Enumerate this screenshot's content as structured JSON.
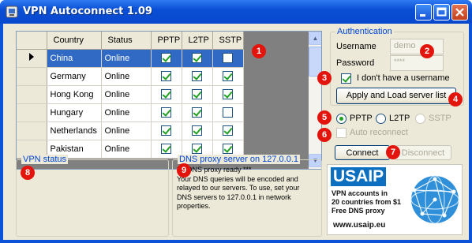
{
  "window": {
    "title": "VPN Autoconnect 1.09"
  },
  "grid": {
    "columns": [
      "Country",
      "Status",
      "PPTP",
      "L2TP",
      "SSTP"
    ],
    "rows": [
      {
        "country": "China",
        "status": "Online",
        "pptp": true,
        "l2tp": true,
        "sstp": false,
        "selected": true
      },
      {
        "country": "Germany",
        "status": "Online",
        "pptp": true,
        "l2tp": true,
        "sstp": true,
        "selected": false
      },
      {
        "country": "Hong Kong",
        "status": "Online",
        "pptp": true,
        "l2tp": true,
        "sstp": true,
        "selected": false
      },
      {
        "country": "Hungary",
        "status": "Online",
        "pptp": true,
        "l2tp": true,
        "sstp": false,
        "selected": false
      },
      {
        "country": "Netherlands",
        "status": "Online",
        "pptp": true,
        "l2tp": true,
        "sstp": true,
        "selected": false
      },
      {
        "country": "Pakistan",
        "status": "Online",
        "pptp": true,
        "l2tp": true,
        "sstp": true,
        "selected": false
      }
    ]
  },
  "auth": {
    "legend": "Authentication",
    "username_label": "Username",
    "username_value": "demo",
    "password_label": "Password",
    "password_value": "****",
    "no_username_label": "I don't have a username",
    "no_username_checked": true,
    "apply_button": "Apply and Load server list"
  },
  "protocol": {
    "pptp": "PPTP",
    "l2tp": "L2TP",
    "sstp": "SSTP",
    "auto_reconnect": "Auto reconnect"
  },
  "actions": {
    "connect": "Connect",
    "disconnect": "Disconnect"
  },
  "vpn_status": {
    "legend": "VPN status"
  },
  "dns": {
    "legend": "DNS proxy server on 127.0.0.1",
    "lines": [
      "*** DNS proxy ready ***",
      "Your DNS queries will be encoded and",
      "relayed to our servers. To use, set your",
      "DNS servers to 127.0.0.1 in network",
      "properties."
    ]
  },
  "ad": {
    "brand": "USAIP",
    "line1": "VPN accounts in",
    "line2": "20 countries from $1",
    "line3": "Free DNS proxy",
    "url": "www.usaip.eu"
  },
  "badges": [
    "1",
    "2",
    "3",
    "4",
    "5",
    "6",
    "7",
    "8",
    "9"
  ],
  "colors": {
    "accent": "#0046d5",
    "badge": "#e3140c",
    "selection": "#316ac5"
  }
}
